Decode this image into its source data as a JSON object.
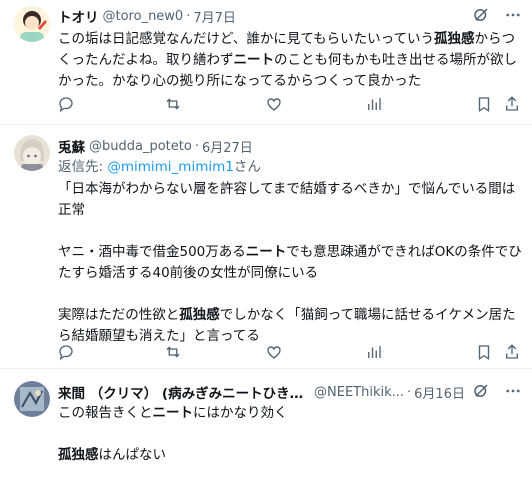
{
  "tweets": [
    {
      "name": "トオリ",
      "handle": "@toro_new0",
      "dot": "·",
      "date": "7月7日",
      "lines": [
        [
          {
            "t": "この垢は日記感覚なんだけど、誰かに見てもらいたいっていう"
          },
          {
            "t": "孤独感",
            "b": true
          },
          {
            "t": "からつ"
          }
        ],
        [
          {
            "t": "くったんだよね。取り繕わず"
          },
          {
            "t": "ニート",
            "b": true
          },
          {
            "t": "のことも何もかも吐き出せる場所が欲し"
          }
        ],
        [
          {
            "t": "かった。かなり心の拠り所になってるからつくって良かった"
          }
        ]
      ]
    },
    {
      "name": "兎蘇",
      "handle": "@budda_poteto",
      "dot": "·",
      "date": "6月27日",
      "reply_label": "返信先: ",
      "reply_mention": "@mimimi_mimim1",
      "reply_suffix": "さん",
      "lines": [
        [
          {
            "t": "「日本海がわからない層を許容してまで結婚するべきか」で悩んでいる間は"
          }
        ],
        [
          {
            "t": "正常"
          }
        ],
        [],
        [
          {
            "t": "ヤニ・酒中毒で借金500万ある"
          },
          {
            "t": "ニート",
            "b": true
          },
          {
            "t": "でも意思疎通ができればOKの条件でひ"
          }
        ],
        [
          {
            "t": "たすら婚活する40前後の女性が同僚にいる"
          }
        ],
        [],
        [
          {
            "t": "実際はただの性欲と"
          },
          {
            "t": "孤独感",
            "b": true
          },
          {
            "t": "でしかなく「猫飼って職場に話せるイケメン居た"
          }
        ],
        [
          {
            "t": "ら結婚願望も消えた」と言ってる"
          }
        ]
      ]
    },
    {
      "name": "来間 （クリマ） (病みぎみニートひきこ...",
      "handle": "@NEEThikik...",
      "dot": "·",
      "date": "6月16日",
      "lines": [
        [
          {
            "t": "この報告きくと"
          },
          {
            "t": "ニート",
            "b": true
          },
          {
            "t": "にはかなり効く"
          }
        ],
        [],
        [
          {
            "t": "孤独感",
            "b": true
          },
          {
            "t": "はんぱない"
          }
        ]
      ]
    }
  ],
  "icons": {
    "reply": "reply-icon",
    "retweet": "retweet-icon",
    "like": "like-icon",
    "views": "views-icon",
    "bookmark": "bookmark-icon",
    "share": "share-icon",
    "grok": "grok-icon",
    "more": "more-icon"
  },
  "colors": {
    "text": "#0f1419",
    "secondary": "#536471",
    "accent": "#1d9bf0",
    "divider": "#eff3f4"
  }
}
